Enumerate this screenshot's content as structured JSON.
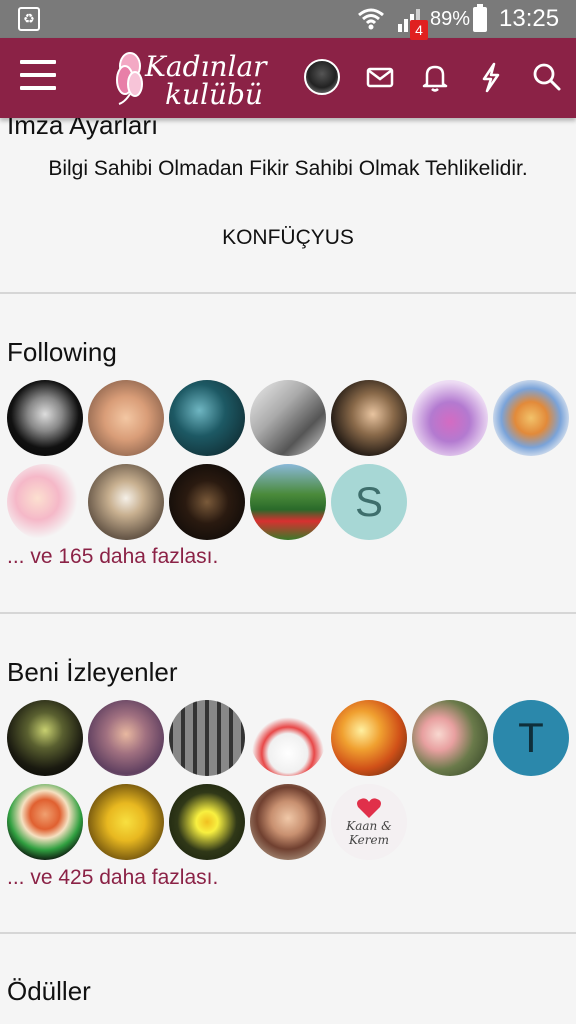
{
  "status_bar": {
    "battery_percent": "89%",
    "time": "13:25"
  },
  "header": {
    "logo_line1": "Kadınlar",
    "logo_line2": "kulübü",
    "notification_count": "4",
    "brand_color": "#8b2246"
  },
  "signature": {
    "title": "İmza Ayarları",
    "quote": "Bilgi Sahibi Olmadan Fikir Sahibi Olmak Tehlikelidir.",
    "author": "KONFÜÇYUS"
  },
  "following": {
    "title": "Following",
    "more_text": "... ve 165 daha fazlası.",
    "avatars": [
      {
        "name": "avatar-bw-woman"
      },
      {
        "name": "avatar-child"
      },
      {
        "name": "avatar-teal-dark"
      },
      {
        "name": "avatar-old-man"
      },
      {
        "name": "avatar-queen"
      },
      {
        "name": "avatar-doll-purple"
      },
      {
        "name": "avatar-cartoon-girl"
      },
      {
        "name": "avatar-baby-cartoon"
      },
      {
        "name": "avatar-kid-photo"
      },
      {
        "name": "avatar-dark-figure"
      },
      {
        "name": "avatar-garden"
      },
      {
        "name": "avatar-letter-s",
        "letter": "S",
        "bg": "#a7d7d5",
        "fg": "#3e6e6c"
      }
    ]
  },
  "followers": {
    "title": "Beni İzleyenler",
    "more_text": "... ve 425 daha fazlası.",
    "avatars": [
      {
        "name": "avatar-reaper"
      },
      {
        "name": "avatar-purple-portrait"
      },
      {
        "name": "avatar-cage"
      },
      {
        "name": "avatar-egg-chick"
      },
      {
        "name": "avatar-sunset"
      },
      {
        "name": "avatar-roses"
      },
      {
        "name": "avatar-letter-t",
        "letter": "T",
        "bg": "#2b88ab",
        "fg": "#0f2f3a"
      },
      {
        "name": "avatar-pebbles"
      },
      {
        "name": "avatar-yellow-flowers"
      },
      {
        "name": "avatar-daisy"
      },
      {
        "name": "avatar-smiling-woman"
      },
      {
        "name": "avatar-kaan-kerem",
        "text": "Kaan & Kerem"
      }
    ]
  },
  "awards": {
    "title": "Ödüller"
  }
}
